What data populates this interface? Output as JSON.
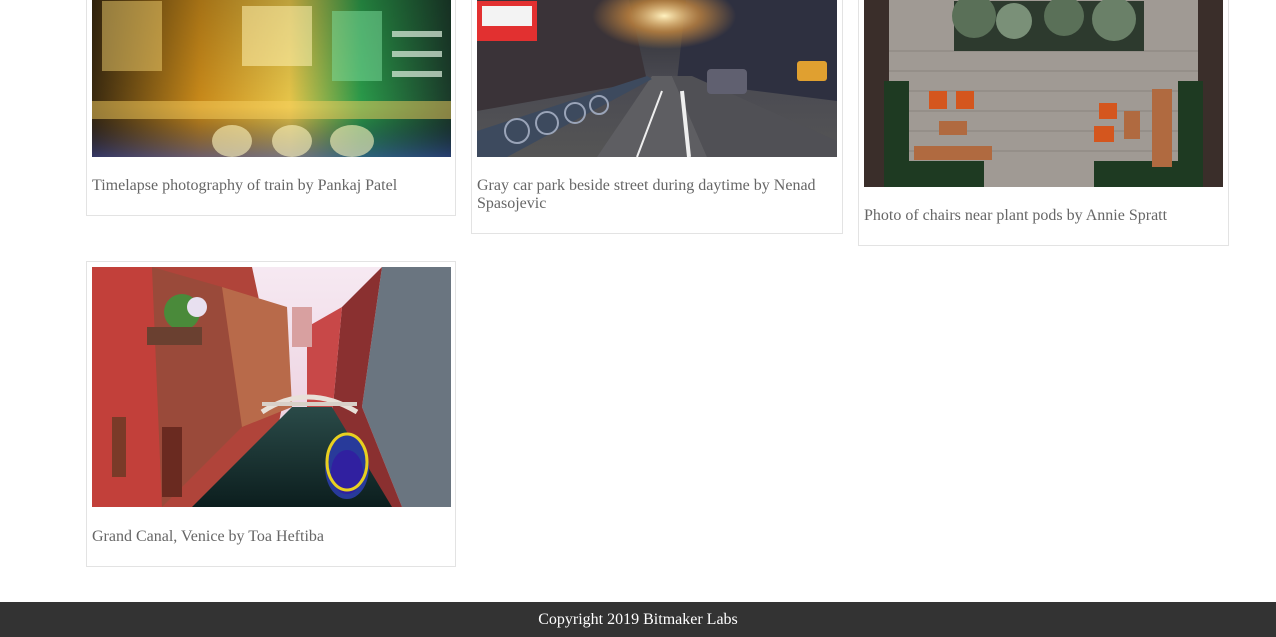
{
  "gallery": {
    "items": [
      {
        "caption": "Timelapse photography of train by Pankaj Patel",
        "image": "train-timelapse-photo"
      },
      {
        "caption": "Gray car park beside street during daytime by Nenad Spasojevic",
        "image": "city-street-bike-rack-photo"
      },
      {
        "caption": "Photo of chairs near plant pods by Annie Spratt",
        "image": "chairs-plant-pods-photo"
      },
      {
        "caption": "Grand Canal, Venice by Toa Heftiba",
        "image": "venice-canal-photo"
      }
    ]
  },
  "footer": {
    "text": "Copyright 2019 Bitmaker Labs"
  }
}
